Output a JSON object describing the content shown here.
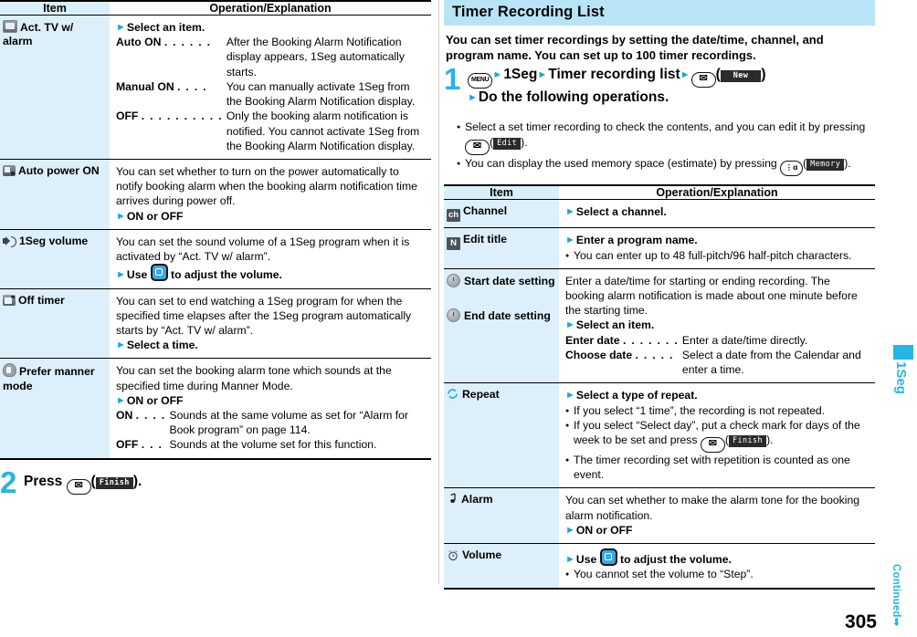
{
  "page": {
    "number": "305",
    "continued_label": "Continued",
    "side_tab_label": "1Seg"
  },
  "left": {
    "table": {
      "headers": {
        "item": "Item",
        "operation": "Operation/Explanation"
      },
      "rows": [
        {
          "icon": "tv-icon",
          "label": "Act. TV w/ alarm",
          "lead": "Select an item.",
          "defs": [
            {
              "term": "Auto ON",
              "dots": ". . . . . .",
              "desc": "After the Booking Alarm Notification display appears, 1Seg automatically starts."
            },
            {
              "term": "Manual ON",
              "dots": ". . . .",
              "desc": "You can manually activate 1Seg from the Booking Alarm Notification display."
            },
            {
              "term": "OFF",
              "dots": ". . . . . . . . . .",
              "desc": "Only the booking alarm notification is notified. You cannot activate 1Seg from the Booking Alarm Notification display."
            }
          ]
        },
        {
          "icon": "power-icon",
          "label": "Auto power ON",
          "body": "You can set whether to turn on the power automatically to notify booking alarm when the booking alarm notification time arrives during power off.",
          "lead": "ON or OFF"
        },
        {
          "icon": "speaker-icon",
          "label": "1Seg volume",
          "body": "You can set the sound volume of a 1Seg program when it is activated by “Act. TV w/ alarm”.",
          "lead_prefix": "Use",
          "lead_key": "nav-key",
          "lead_suffix": "to adjust the volume."
        },
        {
          "icon": "off-timer-icon",
          "label": "Off timer",
          "body": "You can set to end watching a 1Seg program for when the specified time elapses after the 1Seg program automatically starts by “Act. TV w/ alarm”.",
          "lead": "Select a time."
        },
        {
          "icon": "manner-mode-icon",
          "label": "Prefer manner mode",
          "body": "You can set the booking alarm tone which sounds at the specified time during Manner Mode.",
          "lead": "ON or OFF",
          "defs": [
            {
              "term": "ON",
              "dots": ". . . .",
              "desc": "Sounds at the same volume as set for “Alarm for Book program” on page 114."
            },
            {
              "term": "OFF",
              "dots": ". . .",
              "desc": "Sounds at the volume set for this function."
            }
          ]
        }
      ]
    },
    "step2": {
      "number": "2",
      "press_label": "Press",
      "key": "envelope-key",
      "softkey": "Finish",
      "suffix": ")."
    }
  },
  "right": {
    "section_title": "Timer Recording List",
    "lead": "You can set timer recordings by setting the date/time, channel, and program name. You can set up to 100 timer recordings.",
    "step1": {
      "number": "1",
      "menu_key": "MENU",
      "path1": "1Seg",
      "path2": "Timer recording list",
      "mail_key": "envelope-key",
      "softkey_new": "New",
      "line2": "Do the following operations."
    },
    "notes": [
      {
        "pre": "Select a set timer recording to check the contents, and you can edit it by pressing",
        "key": "envelope-key",
        "softkey": "Edit",
        "post": ")."
      },
      {
        "pre": "You can display the used memory space (estimate) by pressing",
        "key": "imode-key",
        "softkey": "Memory",
        "post": ")."
      }
    ],
    "table": {
      "headers": {
        "item": "Item",
        "operation": "Operation/Explanation"
      },
      "rows": [
        {
          "icon": "ch-icon",
          "icon_text": "ch",
          "label": "Channel",
          "lead": "Select a channel."
        },
        {
          "icon": "n-icon",
          "icon_text": "N",
          "label": "Edit title",
          "lead": "Enter a program name.",
          "bullets": [
            "You can enter up to 48 full-pitch/96 half-pitch characters."
          ]
        },
        {
          "icon": "clock-icon",
          "label": "Start date setting",
          "label2_icon": "clock-icon",
          "label2": "End date setting",
          "body": "Enter a date/time for starting or ending recording. The booking alarm notification is made about one minute before the starting time.",
          "lead": "Select an item.",
          "defs": [
            {
              "term": "Enter date",
              "dots": ". . . . . . .",
              "desc": "Enter a date/time directly."
            },
            {
              "term": "Choose date",
              "dots": ". . . . .",
              "desc": "Select a date from the Calendar and enter a time."
            }
          ]
        },
        {
          "icon": "repeat-icon",
          "label": "Repeat",
          "lead": "Select a type of repeat.",
          "bullets": [
            "If you select “1 time”, the recording is not repeated.",
            "If you select “Select day”, put a check mark for days of the week to be set and press",
            "The timer recording set with repetition is counted as one event."
          ],
          "bullet_key": "envelope-key",
          "bullet_softkey": "Finish"
        },
        {
          "icon": "note-icon",
          "label": "Alarm",
          "body": "You can set whether to make the alarm tone for the booking alarm notification.",
          "lead": "ON or OFF"
        },
        {
          "icon": "alarm-clock-icon",
          "label": "Volume",
          "lead_prefix": "Use",
          "lead_key": "nav-key",
          "lead_suffix": "to adjust the volume.",
          "bullets": [
            "You cannot set the volume to “Step”."
          ]
        }
      ]
    }
  },
  "colors": {
    "accent": "#27b4e8",
    "header_fill": "#d9effa",
    "item_fill": "#ddeffb",
    "title_fill": "#b9e4f7",
    "softkey_bg": "#2b2b2b"
  }
}
